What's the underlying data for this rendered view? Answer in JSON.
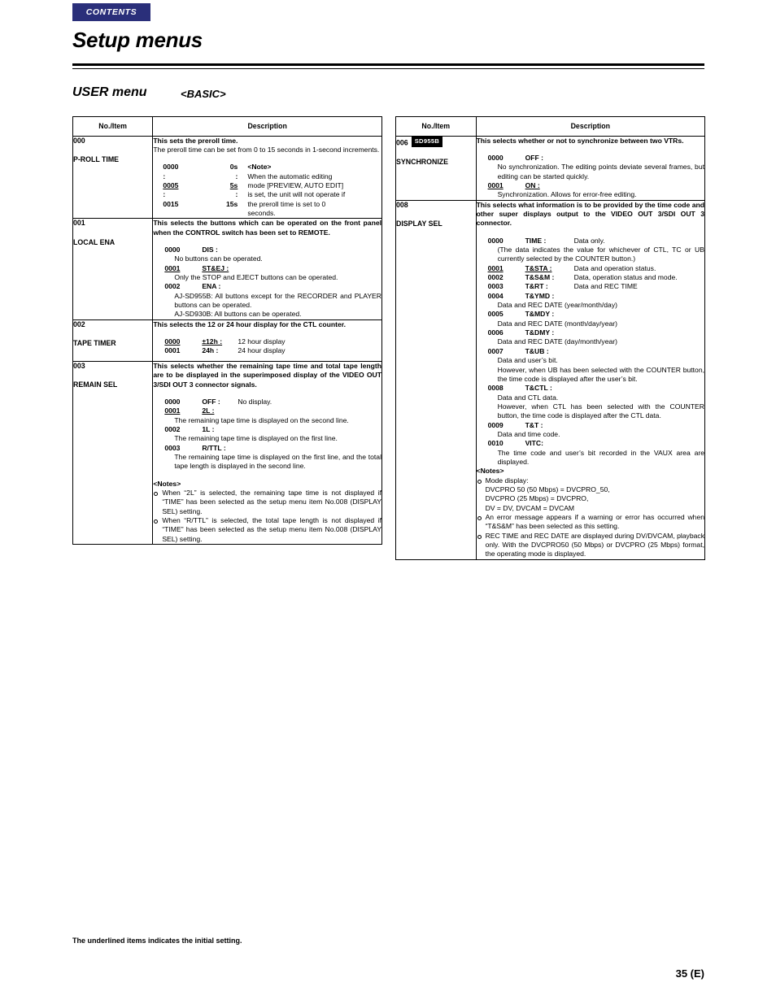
{
  "header": {
    "contents_tab": "CONTENTS",
    "title": "Setup menus",
    "section": "USER menu",
    "section_sub": "<BASIC>"
  },
  "table_headers": {
    "no_item": "No./Item",
    "description": "Description"
  },
  "left_table": {
    "rows": [
      {
        "no": "000",
        "item": "P-ROLL TIME",
        "head": "This sets the preroll time.",
        "body1": "The preroll time can be set from 0 to 15 seconds in 1-second increments.",
        "grid": [
          {
            "code": "0000",
            "val": "0s",
            "note": "<Note>"
          },
          {
            "code": ":",
            "val": ":",
            "note": "When the automatic editing"
          },
          {
            "code": "0005",
            "val": "5s",
            "note": "mode [PREVIEW, AUTO EDIT]"
          },
          {
            "code": ":",
            "val": ":",
            "note": "is set, the unit will not operate if"
          },
          {
            "code": "0015",
            "val": "15s",
            "note": "the preroll time is set to 0"
          },
          {
            "code": "",
            "val": "",
            "note": "seconds."
          }
        ]
      },
      {
        "no": "001",
        "item": "LOCAL ENA",
        "head": "This selects the buttons which can be operated on the front panel when the CONTROL switch has been set to REMOTE.",
        "opts": [
          {
            "code": "0000",
            "val": "DIS :",
            "underline": false,
            "desc": "No buttons can be operated."
          },
          {
            "code": "0001",
            "val": "ST&EJ :",
            "underline": true,
            "desc": "Only the STOP and EJECT buttons can be operated."
          },
          {
            "code": "0002",
            "val": "ENA :",
            "underline": false,
            "desc": "AJ-SD955B: All buttons except for the RECORDER and PLAYER buttons can be operated."
          }
        ],
        "tail": "AJ-SD930B: All buttons can be operated."
      },
      {
        "no": "002",
        "item": "TAPE TIMER",
        "head": "This selects the 12 or 24 hour display for the CTL counter.",
        "opts": [
          {
            "code": "0000",
            "val": "±12h :",
            "underline": true,
            "desc": "12 hour display"
          },
          {
            "code": "0001",
            "val": "24h :",
            "underline": false,
            "desc": "24 hour display"
          }
        ]
      },
      {
        "no": "003",
        "item": "REMAIN SEL",
        "head": "This selects whether the remaining tape time and total tape length are to be displayed in the superimposed display of the VIDEO OUT 3/SDI OUT 3 connector signals.",
        "opts": [
          {
            "code": "0000",
            "val": "OFF :",
            "underline": false,
            "desc": "No display."
          },
          {
            "code": "0001",
            "val": "2L :",
            "underline": true,
            "desc": "The remaining tape time is displayed on the second line."
          },
          {
            "code": "0002",
            "val": "1L :",
            "underline": false,
            "desc": "The remaining tape time is displayed on the first line."
          },
          {
            "code": "0003",
            "val": "R/TTL :",
            "underline": false,
            "desc": "The remaining tape time is displayed on the first line, and the total tape length is displayed in the second line."
          }
        ],
        "notes_title": "<Notes>",
        "notes": [
          "When “2L” is selected, the remaining tape time is not displayed if “TIME” has been selected as the setup menu item No.008 (DISPLAY SEL) setting.",
          "When “R/TTL” is selected, the total tape length is not displayed if “TIME” has been selected as the setup menu item No.008 (DISPLAY SEL) setting."
        ]
      }
    ]
  },
  "right_table": {
    "rows": [
      {
        "no": "006",
        "badge": "SD955B",
        "item": "SYNCHRONIZE",
        "head": "This selects whether or not to synchronize between two VTRs.",
        "opts": [
          {
            "code": "0000",
            "val": "OFF :",
            "underline": false,
            "desc": "No synchronization.  The editing points deviate several frames, but editing can be started quickly."
          },
          {
            "code": "0001",
            "val": "ON :",
            "underline": true,
            "desc": "Synchronization.  Allows for error-free editing."
          }
        ]
      },
      {
        "no": "008",
        "item": "DISPLAY SEL",
        "head": "This selects what information is to be provided by the time code and other super displays output to the VIDEO OUT 3/SDI OUT 3 connector.",
        "opts2": [
          {
            "code": "0000",
            "val": "TIME :",
            "underline": false,
            "inline": "Data only.",
            "desc": "(The data indicates the value for whichever of CTL, TC or UB currently selected by the COUNTER button.)"
          },
          {
            "code": "0001",
            "val": "T&STA :",
            "underline": true,
            "inline": "Data and operation status.",
            "desc": ""
          },
          {
            "code": "0002",
            "val": "T&S&M :",
            "underline": false,
            "inline": "Data, operation status and mode.",
            "desc": ""
          },
          {
            "code": "0003",
            "val": "T&RT :",
            "underline": false,
            "inline": "Data and REC TIME",
            "desc": ""
          },
          {
            "code": "0004",
            "val": "T&YMD :",
            "underline": false,
            "inline": "",
            "desc": "Data and REC DATE (year/month/day)"
          },
          {
            "code": "0005",
            "val": "T&MDY :",
            "underline": false,
            "inline": "",
            "desc": "Data and REC DATE (month/day/year)"
          },
          {
            "code": "0006",
            "val": "T&DMY :",
            "underline": false,
            "inline": "",
            "desc": "Data and REC DATE (day/month/year)"
          },
          {
            "code": "0007",
            "val": "T&UB :",
            "underline": false,
            "inline": "",
            "desc": "Data and user’s bit.\nHowever, when UB has been selected with the COUNTER button, the time code is displayed after the user’s bit."
          },
          {
            "code": "0008",
            "val": "T&CTL :",
            "underline": false,
            "inline": "",
            "desc": "Data and CTL data.\nHowever, when CTL has been selected with the COUNTER button, the time code is displayed after the CTL data."
          },
          {
            "code": "0009",
            "val": "T&T :",
            "underline": false,
            "inline": "",
            "desc": "Data and time code."
          },
          {
            "code": "0010",
            "val": "VITC:",
            "underline": false,
            "inline": "",
            "desc": "The time code and user’s bit recorded in the VAUX area are displayed."
          }
        ],
        "notes_title": "<Notes>",
        "notes": [
          "Mode display:\nDVCPRO 50 (50 Mbps) = DVCPRO_50,\nDVCPRO (25 Mbps) = DVCPRO,\nDV = DV, DVCAM = DVCAM",
          "An error message appears if a warning or error has occurred when “T&S&M” has been selected as this setting.",
          "REC TIME and REC DATE are displayed during DV/DVCAM, playback only.  With the DVCPRO50 (50 Mbps) or DVCPRO (25 Mbps) format, the operating mode is displayed."
        ]
      }
    ]
  },
  "footer": {
    "footnote": "The underlined items indicates the initial setting.",
    "page_number": "35 (E)"
  }
}
